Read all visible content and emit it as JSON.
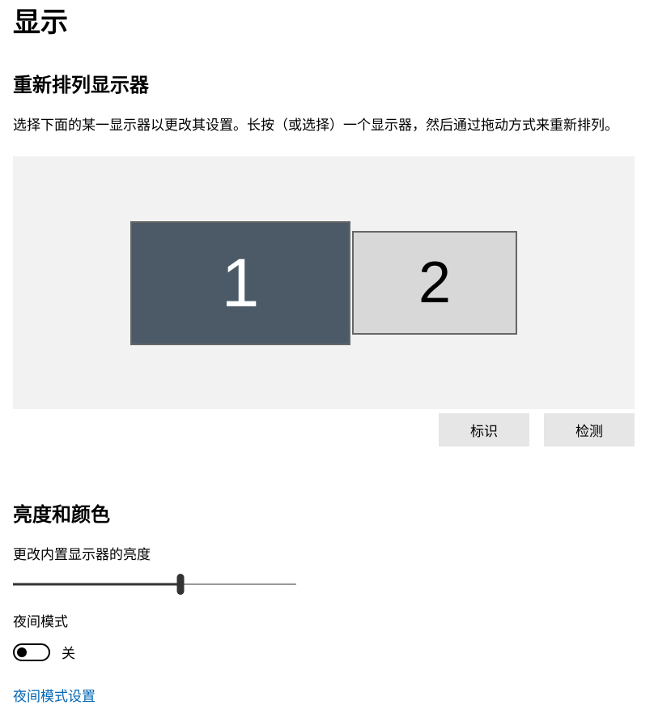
{
  "page": {
    "title": "显示"
  },
  "rearrange": {
    "heading": "重新排列显示器",
    "description": "选择下面的某一显示器以更改其设置。长按（或选择）一个显示器，然后通过拖动方式来重新排列。",
    "monitors": {
      "primary": "1",
      "secondary": "2"
    },
    "identify_label": "标识",
    "detect_label": "检测"
  },
  "brightness": {
    "heading": "亮度和颜色",
    "slider_label": "更改内置显示器的亮度",
    "slider_value_percent": 59,
    "night_mode_label": "夜间模式",
    "night_mode_state": "关",
    "night_mode_settings_link": "夜间模式设置"
  }
}
